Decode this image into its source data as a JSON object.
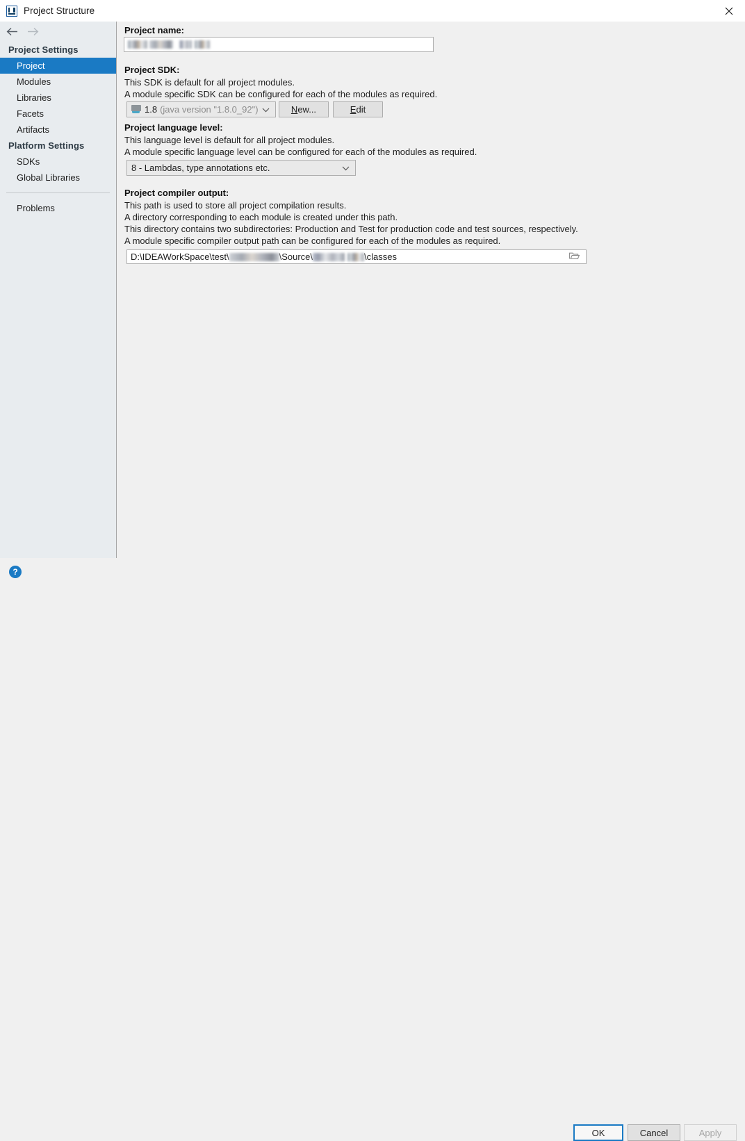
{
  "window": {
    "title": "Project Structure",
    "app_icon": "intellij-idea-icon",
    "close_icon": "close-icon"
  },
  "sidebar": {
    "back_icon": "arrow-left-icon",
    "forward_icon": "arrow-right-icon",
    "groups": [
      {
        "label": "Project Settings",
        "items": [
          {
            "label": "Project",
            "selected": true
          },
          {
            "label": "Modules",
            "selected": false
          },
          {
            "label": "Libraries",
            "selected": false
          },
          {
            "label": "Facets",
            "selected": false
          },
          {
            "label": "Artifacts",
            "selected": false
          }
        ]
      },
      {
        "label": "Platform Settings",
        "items": [
          {
            "label": "SDKs",
            "selected": false
          },
          {
            "label": "Global Libraries",
            "selected": false
          }
        ]
      }
    ],
    "problems_label": "Problems"
  },
  "main": {
    "project_name": {
      "label": "Project name:",
      "value": "",
      "redacted": true
    },
    "project_sdk": {
      "label": "Project SDK:",
      "desc_line1": "This SDK is default for all project modules.",
      "desc_line2": "A module specific SDK can be configured for each of the modules as required.",
      "sdk_icon": "sdk-module-icon",
      "selected_version": "1.8",
      "selected_detail": "(java version \"1.8.0_92\")",
      "dropdown_icon": "chevron-down-icon",
      "new_button": {
        "before": "",
        "mnemonic": "N",
        "after": "ew..."
      },
      "edit_button": {
        "before": "",
        "mnemonic": "E",
        "after": "dit"
      }
    },
    "language_level": {
      "label": "Project language level:",
      "desc_line1": "This language level is default for all project modules.",
      "desc_line2": "A module specific language level can be configured for each of the modules as required.",
      "selected": "8 - Lambdas, type annotations etc.",
      "dropdown_icon": "chevron-down-icon"
    },
    "compiler_output": {
      "label": "Project compiler output:",
      "desc_line1": "This path is used to store all project compilation results.",
      "desc_line2": "A directory corresponding to each module is created under this path.",
      "desc_line3": "This directory contains two subdirectories: Production and Test for production code and test sources, respectively.",
      "desc_line4": "A module specific compiler output path can be configured for each of the modules as required.",
      "path_prefix": "D:\\IDEAWorkSpace\\test\\",
      "path_middle": "\\Source\\",
      "path_suffix": "\\classes",
      "browse_icon": "folder-browse-icon"
    }
  },
  "footer": {
    "help_icon": "help-question-icon",
    "help_label": "?",
    "ok_label": "OK",
    "cancel_label": "Cancel",
    "apply_label": "Apply",
    "apply_disabled": true
  },
  "colors": {
    "accent": "#1a7ac4",
    "sidebar_bg": "#e8ecef",
    "panel_bg": "#f0f0f0",
    "titlebar_bg": "#ffffff"
  }
}
